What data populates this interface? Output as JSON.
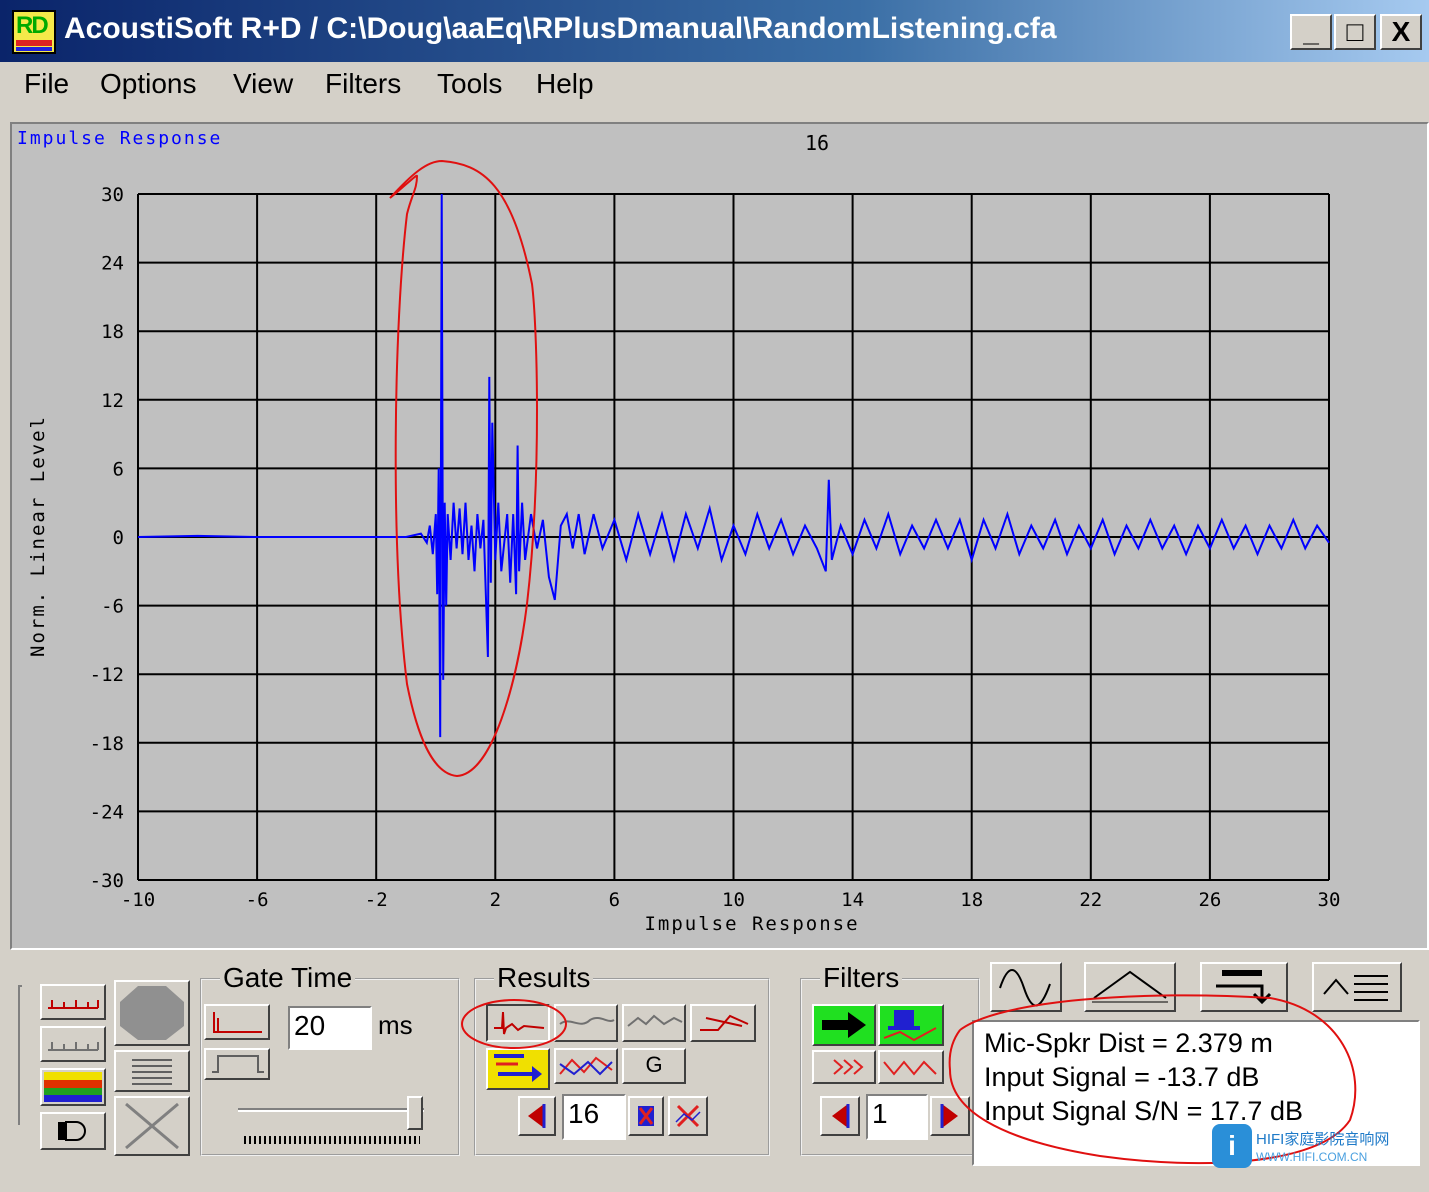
{
  "window": {
    "icon_label": "RD",
    "title": "AcoustiSoft R+D / C:\\Doug\\aaEq\\RPlusDmanual\\RandomListening.cfa",
    "minimize": "_",
    "maximize": "□",
    "close": "X"
  },
  "menu": [
    "File",
    "Options",
    "View",
    "Filters",
    "Tools",
    "Help"
  ],
  "chart_data": {
    "type": "line",
    "title": "16",
    "corner_label": "Impulse Response",
    "xlabel": "Impulse Response",
    "ylabel": "Norm. Linear Level",
    "xlim": [
      -10,
      30
    ],
    "ylim": [
      -30,
      30
    ],
    "xticks": [
      -10,
      -6,
      -2,
      2,
      6,
      10,
      14,
      18,
      22,
      26,
      30
    ],
    "yticks": [
      30,
      24,
      18,
      12,
      6,
      0,
      -6,
      -12,
      -18,
      -24,
      -30
    ],
    "grid": true,
    "series_color": "#0000ff",
    "annotation_color": "#e01010",
    "points": [
      [
        -10,
        0
      ],
      [
        -8,
        0.1
      ],
      [
        -6,
        0
      ],
      [
        -4,
        0
      ],
      [
        -2,
        0
      ],
      [
        -1,
        0
      ],
      [
        -0.5,
        0.3
      ],
      [
        -0.3,
        -0.5
      ],
      [
        -0.2,
        1
      ],
      [
        -0.1,
        -1.5
      ],
      [
        0,
        2
      ],
      [
        0.05,
        -5
      ],
      [
        0.1,
        6
      ],
      [
        0.15,
        -17.5
      ],
      [
        0.2,
        30
      ],
      [
        0.25,
        -12.5
      ],
      [
        0.3,
        3
      ],
      [
        0.35,
        -6
      ],
      [
        0.4,
        2
      ],
      [
        0.5,
        -2
      ],
      [
        0.6,
        3
      ],
      [
        0.7,
        -1
      ],
      [
        0.8,
        2.5
      ],
      [
        0.9,
        -1.5
      ],
      [
        1,
        3
      ],
      [
        1.1,
        -2
      ],
      [
        1.2,
        1
      ],
      [
        1.3,
        -3
      ],
      [
        1.4,
        2
      ],
      [
        1.5,
        -1
      ],
      [
        1.6,
        1.5
      ],
      [
        1.75,
        -10.5
      ],
      [
        1.8,
        14
      ],
      [
        1.85,
        -4
      ],
      [
        1.9,
        10
      ],
      [
        2,
        -2
      ],
      [
        2.1,
        3
      ],
      [
        2.2,
        -3
      ],
      [
        2.4,
        2
      ],
      [
        2.5,
        -4
      ],
      [
        2.6,
        2
      ],
      [
        2.7,
        -5
      ],
      [
        2.75,
        8
      ],
      [
        2.8,
        -3
      ],
      [
        2.9,
        3
      ],
      [
        3,
        -2
      ],
      [
        3.2,
        2
      ],
      [
        3.4,
        -1
      ],
      [
        3.6,
        1.5
      ],
      [
        3.8,
        -3.5
      ],
      [
        4,
        -5.5
      ],
      [
        4.2,
        1
      ],
      [
        4.4,
        2
      ],
      [
        4.6,
        -1
      ],
      [
        4.8,
        2
      ],
      [
        5,
        -1.5
      ],
      [
        5.3,
        2
      ],
      [
        5.6,
        -1
      ],
      [
        6,
        1.5
      ],
      [
        6.4,
        -2
      ],
      [
        6.8,
        2
      ],
      [
        7.2,
        -1.5
      ],
      [
        7.6,
        2
      ],
      [
        8,
        -2
      ],
      [
        8.4,
        2
      ],
      [
        8.8,
        -1
      ],
      [
        9.2,
        2.5
      ],
      [
        9.6,
        -2
      ],
      [
        10,
        1
      ],
      [
        10.4,
        -1.5
      ],
      [
        10.8,
        2
      ],
      [
        11.2,
        -1
      ],
      [
        11.6,
        1.5
      ],
      [
        12,
        -1.5
      ],
      [
        12.4,
        1
      ],
      [
        12.8,
        -1
      ],
      [
        13.1,
        -3
      ],
      [
        13.2,
        5
      ],
      [
        13.3,
        -2
      ],
      [
        13.6,
        1
      ],
      [
        14,
        -1.5
      ],
      [
        14.4,
        1.5
      ],
      [
        14.8,
        -1
      ],
      [
        15.2,
        2
      ],
      [
        15.6,
        -1.5
      ],
      [
        16,
        1
      ],
      [
        16.4,
        -1
      ],
      [
        16.8,
        1.5
      ],
      [
        17.2,
        -1
      ],
      [
        17.6,
        1.5
      ],
      [
        18,
        -2
      ],
      [
        18.4,
        1.5
      ],
      [
        18.8,
        -1
      ],
      [
        19.2,
        2
      ],
      [
        19.6,
        -1.5
      ],
      [
        20,
        1
      ],
      [
        20.4,
        -1
      ],
      [
        20.8,
        1.5
      ],
      [
        21.2,
        -1.5
      ],
      [
        21.6,
        1
      ],
      [
        22,
        -1
      ],
      [
        22.4,
        1.5
      ],
      [
        22.8,
        -1.5
      ],
      [
        23.2,
        1
      ],
      [
        23.6,
        -1
      ],
      [
        24,
        1.5
      ],
      [
        24.4,
        -1
      ],
      [
        24.8,
        1
      ],
      [
        25.2,
        -1.5
      ],
      [
        25.6,
        1
      ],
      [
        26,
        -1
      ],
      [
        26.4,
        1.5
      ],
      [
        26.8,
        -1
      ],
      [
        27.2,
        1
      ],
      [
        27.6,
        -1.5
      ],
      [
        28,
        1
      ],
      [
        28.4,
        -1
      ],
      [
        28.8,
        1.5
      ],
      [
        29.2,
        -1
      ],
      [
        29.6,
        1
      ],
      [
        30,
        -0.5
      ]
    ]
  },
  "gate": {
    "title": "Gate Time",
    "value": "20",
    "unit": "ms",
    "slider_value": 0.95
  },
  "results": {
    "title": "Results",
    "g_label": "G",
    "index": "16"
  },
  "filters": {
    "title": "Filters",
    "index": "1"
  },
  "info": {
    "line1": "Mic-Spkr Dist = 2.379 m",
    "line2": "Input Signal = -13.7 dB",
    "line3": "Input Signal S/N = 17.7 dB"
  },
  "watermark": {
    "logo": "i",
    "line1": "HIFI家庭影院音响网",
    "line2": "WWW.HIFI.COM.CN"
  }
}
